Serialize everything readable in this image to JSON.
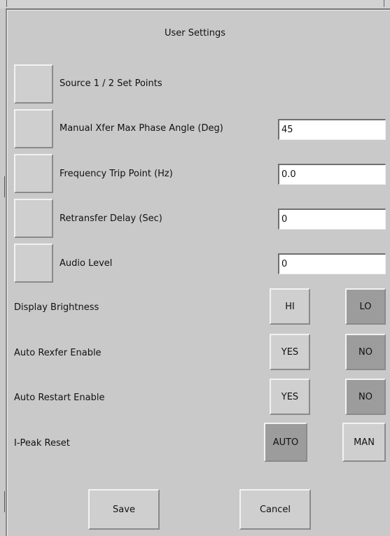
{
  "window": {
    "title": "User Settings"
  },
  "rows": {
    "source_set_points": {
      "label": "Source 1 / 2 Set Points"
    },
    "manual_xfer": {
      "label": "Manual Xfer Max Phase Angle (Deg)",
      "value": "45"
    },
    "frequency_trip": {
      "label": "Frequency Trip Point (Hz)",
      "value": "0.0"
    },
    "retransfer_delay": {
      "label": "Retransfer Delay (Sec)",
      "value": "0"
    },
    "audio_level": {
      "label": "Audio Level",
      "value": "0"
    }
  },
  "toggles": {
    "display_brightness": {
      "label": "Display Brightness",
      "option_a": "HI",
      "option_b": "LO",
      "selected": "LO"
    },
    "auto_rexfer": {
      "label": "Auto Rexfer Enable",
      "option_a": "YES",
      "option_b": "NO",
      "selected": "NO"
    },
    "auto_restart": {
      "label": "Auto Restart Enable",
      "option_a": "YES",
      "option_b": "NO",
      "selected": "NO"
    },
    "i_peak_reset": {
      "label": "I-Peak Reset",
      "option_a": "AUTO",
      "option_b": "MAN",
      "selected": "AUTO"
    }
  },
  "actions": {
    "save": "Save",
    "cancel": "Cancel"
  },
  "colors": {
    "background": "#c9c9c9",
    "button_face": "#cfcfcf",
    "button_selected": "#9c9c9c",
    "field_bg": "#ffffff"
  }
}
